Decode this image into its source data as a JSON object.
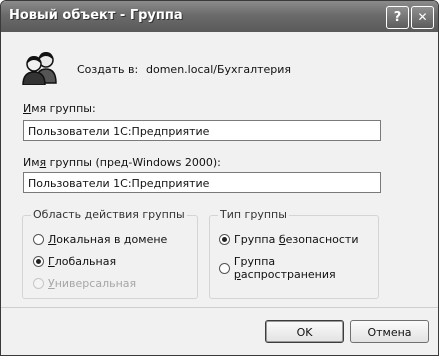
{
  "window": {
    "title": "Новый объект - Группа",
    "help_label": "?",
    "close_label": "✕"
  },
  "create": {
    "label": "Создать в:",
    "path": "domen.local/Бухгалтерия",
    "icon": "users-group-icon"
  },
  "group_name": {
    "label_accel": "И",
    "label_rest": "мя группы:",
    "value": "Пользователи 1С:Предприятие"
  },
  "group_name_legacy": {
    "label_pre": "Им",
    "label_accel": "я",
    "label_rest": " группы (пред-Windows 2000):",
    "value": "Пользователи 1С:Предприятие"
  },
  "scope": {
    "legend": "Область действия группы",
    "options": [
      {
        "accel": "Л",
        "rest": "окальная в домене",
        "checked": false,
        "disabled": false
      },
      {
        "accel": "Г",
        "rest": "лобальная",
        "checked": true,
        "disabled": false
      },
      {
        "accel": "У",
        "rest": "ниверсальная",
        "checked": false,
        "disabled": true
      }
    ]
  },
  "type": {
    "legend": "Тип группы",
    "options": [
      {
        "pre": "Группа ",
        "accel": "б",
        "rest": "езопасности",
        "checked": true
      },
      {
        "pre": "Группа ",
        "accel": "р",
        "rest": "аспространения",
        "checked": false
      }
    ]
  },
  "buttons": {
    "ok": "OK",
    "cancel": "Отмена"
  }
}
